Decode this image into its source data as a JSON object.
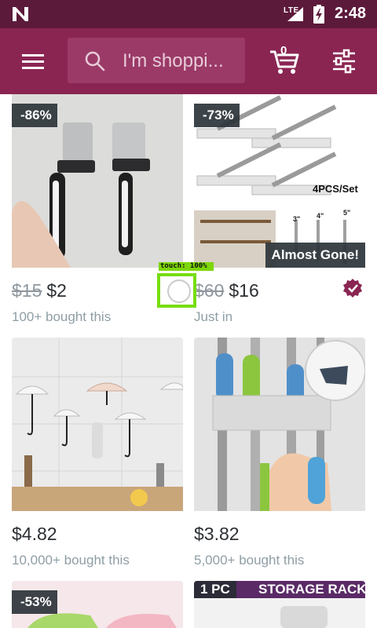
{
  "status_bar": {
    "network": "LTE",
    "time": "2:48"
  },
  "app_bar": {
    "search_placeholder": "I'm shoppi...",
    "cart_count": "0"
  },
  "products": [
    {
      "discount": "-86%",
      "old_price": "$15",
      "price": "$2",
      "subtitle": "100+ bought this"
    },
    {
      "discount": "-73%",
      "image_caption": "4PCS/Set",
      "image_dims": [
        "3\"",
        "4\"",
        "5\""
      ],
      "tag": "Almost Gone!",
      "old_price": "$60",
      "price": "$16",
      "subtitle": "Just in"
    },
    {
      "price": "$4.82",
      "subtitle": "10,000+ bought this"
    },
    {
      "price": "$3.82",
      "subtitle": "5,000+ bought this"
    },
    {
      "discount": "-53%"
    },
    {
      "banner": "1 PC",
      "banner_text": "STORAGE RACK"
    }
  ],
  "touch_overlay": {
    "label": "touch: 100%"
  },
  "colors": {
    "status_bar": "#5c1a3a",
    "app_bar": "#8a2552",
    "verified_badge": "#8a2552",
    "touch": "#77dd11"
  }
}
